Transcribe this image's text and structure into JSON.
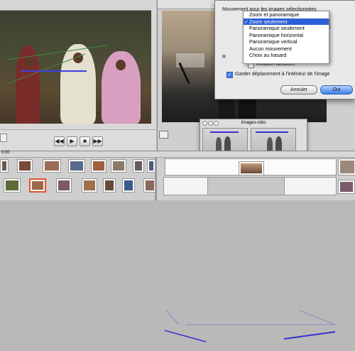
{
  "dialog": {
    "label": "Mouvement pour les images sélectionnées",
    "options": [
      "Zoom et panoramique",
      "Zoom seulement",
      "Panoramique seulement",
      "Panoramique horizontal",
      "Panoramique vertical",
      "Aucun mouvement",
      "Choix au hasard"
    ],
    "selected_index": 1,
    "checkmark": "✓",
    "random_rotation": "Rotation aléatoire",
    "keep_inside": "Garder déplacement à l'intérieur de l'image",
    "cancel": "Annuler",
    "ok": "Oui",
    "prefix_letter": "R"
  },
  "keyframes": {
    "title": "Images-clés"
  },
  "player": {
    "prev": "◀◀",
    "play": "▶",
    "stop": "■",
    "next": "▶▶"
  },
  "timeline": {
    "ruler_start": "0:00"
  },
  "colors": {
    "selection": "#2c5fd6",
    "primary_button": "#3b7de8",
    "motion_path": "#3a2fd0"
  }
}
